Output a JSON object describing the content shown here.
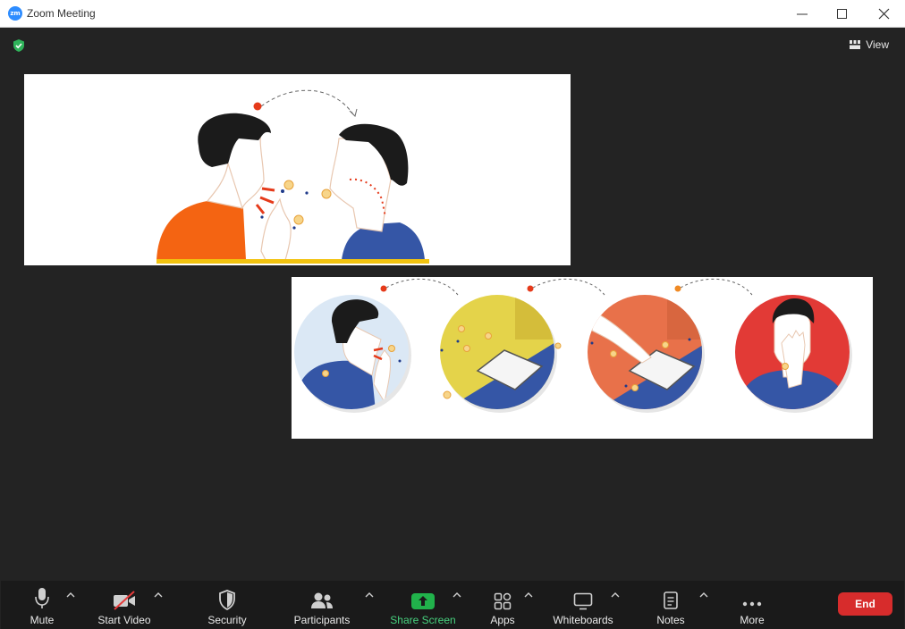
{
  "window": {
    "app_icon_text": "zm",
    "title": "Zoom Meeting"
  },
  "header": {
    "view_label": "View",
    "security_status_icon": "shield-check-icon",
    "accent_green": "#2fb35a"
  },
  "shared_content": {
    "panels": [
      {
        "description_icon": "cough-transmission-illustration"
      },
      {
        "description_icon": "surface-contamination-illustration"
      }
    ]
  },
  "toolbar": {
    "mute": "Mute",
    "start_video": "Start Video",
    "security": "Security",
    "participants": "Participants",
    "share_screen": "Share Screen",
    "apps": "Apps",
    "whiteboards": "Whiteboards",
    "notes": "Notes",
    "more": "More",
    "end": "End",
    "end_color": "#d72c2c",
    "share_color": "#21b24b"
  }
}
